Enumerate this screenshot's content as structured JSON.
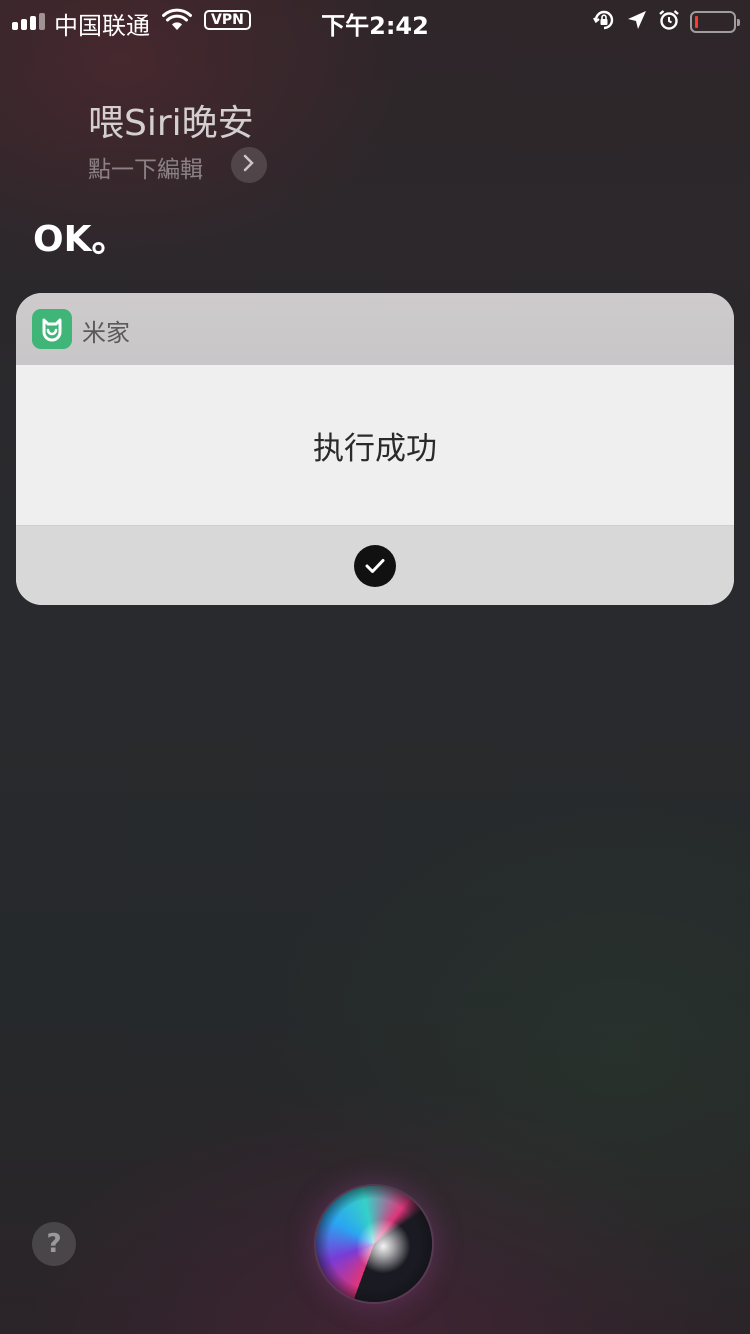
{
  "status_bar": {
    "carrier": "中国联通",
    "vpn_label": "VPN",
    "time": "下午2:42",
    "icons": [
      "signal-icon",
      "wifi-icon",
      "rotation-lock-icon",
      "location-icon",
      "alarm-icon",
      "battery-icon"
    ],
    "battery_level": 0.08,
    "battery_color": "#ff3b30"
  },
  "siri": {
    "query": "喂Siri晚安",
    "edit_hint": "點一下編輯",
    "response": "OK。"
  },
  "card": {
    "app_name": "米家",
    "app_icon_color": "#3fb577",
    "message": "执行成功"
  },
  "bottom": {
    "help_label": "?"
  }
}
